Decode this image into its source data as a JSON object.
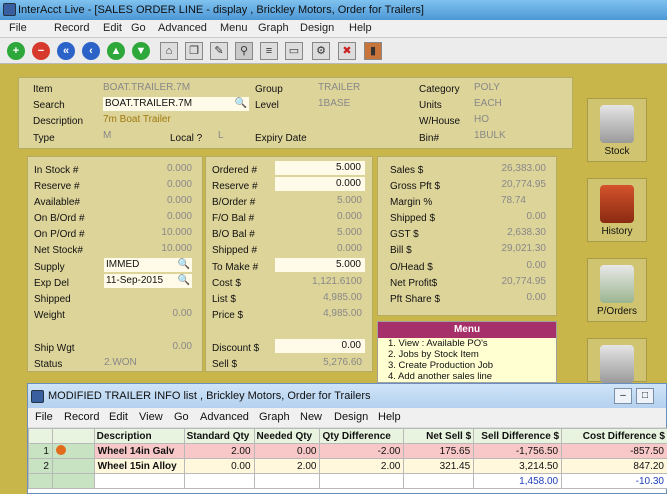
{
  "title_bar": {
    "text": "InterAcct Live - [SALES ORDER LINE - display , Brickley Motors, Order for Trailers]"
  },
  "menu": [
    "File",
    "Record",
    "Edit",
    "Go",
    "Advanced",
    "Menu",
    "Graph",
    "Design",
    "Help"
  ],
  "toolbar": {
    "icons": [
      "add-icon",
      "remove-icon",
      "first-icon",
      "previous-icon",
      "up-icon",
      "down-icon",
      "home-icon",
      "copy-icon",
      "edit-icon",
      "search-icon",
      "list-icon",
      "monitor-icon",
      "settings-icon",
      "delete-icon",
      "exit-icon"
    ]
  },
  "item": {
    "item_label": "Item",
    "item_value": "BOAT.TRAILER.7M",
    "search_label": "Search",
    "search_value": "BOAT.TRAILER.7M",
    "description_label": "Description",
    "description_value": "7m Boat Trailer",
    "type_label": "Type",
    "type_value": "M",
    "local_label": "Local ?",
    "local_value": "L",
    "group_label": "Group",
    "group_value": "TRAILER",
    "level_label": "Level",
    "level_value": "1BASE",
    "expiry_label": "Expiry Date",
    "expiry_value": "",
    "category_label": "Category",
    "category_value": "POLY",
    "units_label": "Units",
    "units_value": "EACH",
    "warehouse_label": "W/House",
    "warehouse_value": "HO",
    "bin_label": "Bin#",
    "bin_value": "1BULK"
  },
  "stock": {
    "in_stock_label": "In Stock #",
    "in_stock": "0.000",
    "reserve_label": "Reserve  #",
    "reserve": "0.000",
    "available_label": "Available#",
    "available": "0.000",
    "on_bord_label": "On B/Ord #",
    "on_bord": "0.000",
    "on_pord_label": "On P/Ord #",
    "on_pord": "10.000",
    "net_stock_label": "Net Stock#",
    "net_stock": "10.000",
    "supply_label": "Supply",
    "supply_value": "IMMED",
    "exp_del_label": "Exp Del",
    "exp_del_value": "11-Sep-2015",
    "shipped_label": "Shipped",
    "weight_label": "Weight",
    "weight": "0.00",
    "ship_wgt_label": "Ship Wgt",
    "ship_wgt": "0.00",
    "status_label": "Status",
    "status_value": "2.WON"
  },
  "order": {
    "ordered_label": "Ordered #",
    "ordered": "5.000",
    "reserve_label": "Reserve #",
    "reserve": "0.000",
    "border_label": "B/Order #",
    "border": "5.000",
    "fobal_label": "F/O Bal #",
    "fobal": "0.000",
    "bobal_label": "B/O Bal #",
    "bobal": "5.000",
    "shipped_label": "Shipped #",
    "shipped": "0.000",
    "to_make_label": "To Make #",
    "to_make": "5.000",
    "cost_label": "Cost  $",
    "cost": "1,121.6100",
    "list_label": "List  $",
    "list": "4,985.00",
    "price_label": "Price  $",
    "price": "4,985.00",
    "discount_label": "Discount $",
    "discount": "0.00",
    "sell_label": "Sell  $",
    "sell": "5,276.60"
  },
  "sales": {
    "sales_label": "Sales  $",
    "sales": "26,383.00",
    "gross_pft_label": "Gross Pft $",
    "gross_pft": "20,774.95",
    "margin_label": "Margin %",
    "margin": "78.74",
    "shipped_label": "Shipped  $",
    "shipped": "0.00",
    "gst_label": "GST  $",
    "gst": "2,638.30",
    "bill_label": "Bill  $",
    "bill": "29,021.30",
    "ohead_label": "O/Head $",
    "ohead": "0.00",
    "net_profit_label": "Net Profit$",
    "net_profit": "20,774.95",
    "pft_share_label": "Pft Share $",
    "pft_share": "0.00"
  },
  "menu_box": {
    "header": "Menu",
    "items": [
      "1. View : Available PO's",
      "2. Jobs by Stock Item",
      "3. Create Production Job",
      "4. Add another sales line"
    ]
  },
  "side_buttons": [
    {
      "label": "Stock",
      "icon": "shopping-cart-icon"
    },
    {
      "label": "History",
      "icon": "history-book-icon"
    },
    {
      "label": "P/Orders",
      "icon": "cart-add-icon"
    },
    {
      "label": "",
      "icon": "cart-icon"
    }
  ],
  "subwindow": {
    "title": "MODIFIED TRAILER INFO list , Brickley Motors, Order for Trailers",
    "menu": [
      "File",
      "Record",
      "Edit",
      "View",
      "Go",
      "Advanced",
      "Graph",
      "New",
      "Design",
      "Help"
    ],
    "columns": [
      "Description",
      "Standard Qty",
      "Needed Qty",
      "Qty Difference",
      "Net Sell $",
      "Sell Difference $",
      "Cost Difference $"
    ],
    "rows": [
      {
        "num": "1",
        "description": "Wheel  14in Galv",
        "standard_qty": "2.00",
        "needed_qty": "0.00",
        "qty_diff": "-2.00",
        "net_sell": "175.65",
        "sell_diff": "-1,756.50",
        "cost_diff": "-857.50"
      },
      {
        "num": "2",
        "description": "Wheel  15in Alloy",
        "standard_qty": "0.00",
        "needed_qty": "2.00",
        "qty_diff": "2.00",
        "net_sell": "321.45",
        "sell_diff": "3,214.50",
        "cost_diff": "847.20"
      }
    ],
    "totals": {
      "sell_diff": "1,458.00",
      "cost_diff": "-10.30"
    }
  },
  "colors": {
    "background": "#c9b64a",
    "panel": "#ddd49a",
    "menu_header": "#a6306a",
    "row_highlight": "#f8c8c8",
    "total_text": "#1d3fb8"
  }
}
